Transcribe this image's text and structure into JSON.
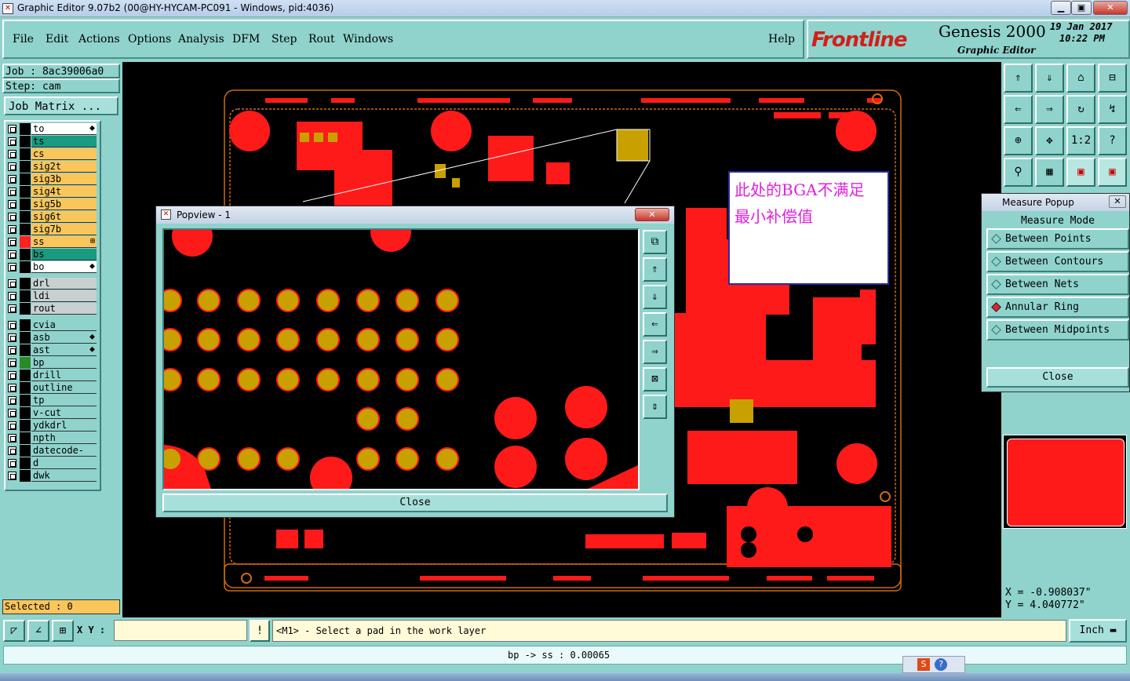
{
  "window": {
    "title": "Graphic Editor 9.07b2 (00@HY-HYCAM-PC091 - Windows, pid:4036)",
    "icon_glyph": "✕"
  },
  "menu": [
    "File",
    "Edit",
    "Actions",
    "Options",
    "Analysis",
    "DFM",
    "Step",
    "Rout",
    "Windows"
  ],
  "help_label": "Help",
  "brand": {
    "logo": "Frontline",
    "product": "Genesis 2000",
    "subtitle": "Graphic Editor",
    "date": "19 Jan 2017",
    "time": "10:22 PM"
  },
  "job": {
    "job_label": "Job : 8ac39006a0",
    "step_label": "Step: cam",
    "matrix_button": "Job Matrix ..."
  },
  "layers_group1": [
    {
      "name": "to",
      "color": "#ffffff",
      "swatch": "#000000",
      "icon": "⬥"
    },
    {
      "name": "ts",
      "color": "#1a9a80",
      "swatch": "#000000",
      "icon": ""
    },
    {
      "name": "cs",
      "color": "#f8c65b",
      "swatch": "#000000",
      "icon": ""
    },
    {
      "name": "sig2t",
      "color": "#f8c65b",
      "swatch": "#000000",
      "icon": ""
    },
    {
      "name": "sig3b",
      "color": "#f8c65b",
      "swatch": "#000000",
      "icon": ""
    },
    {
      "name": "sig4t",
      "color": "#f8c65b",
      "swatch": "#000000",
      "icon": ""
    },
    {
      "name": "sig5b",
      "color": "#f8c65b",
      "swatch": "#000000",
      "icon": ""
    },
    {
      "name": "sig6t",
      "color": "#f8c65b",
      "swatch": "#000000",
      "icon": ""
    },
    {
      "name": "sig7b",
      "color": "#f8c65b",
      "swatch": "#000000",
      "icon": ""
    },
    {
      "name": "ss",
      "color": "#f8c65b",
      "swatch": "#ff2020",
      "icon": "⊞"
    },
    {
      "name": "bs",
      "color": "#1a9a80",
      "swatch": "#000000",
      "icon": ""
    },
    {
      "name": "bo",
      "color": "#ffffff",
      "swatch": "#000000",
      "icon": "⬥"
    }
  ],
  "layers_group2": [
    {
      "name": "drl",
      "color": "#c8d0d0",
      "swatch": "#000000",
      "icon": ""
    },
    {
      "name": "ldi",
      "color": "#c8d0d0",
      "swatch": "#000000",
      "icon": ""
    },
    {
      "name": "rout",
      "color": "#c8d0d0",
      "swatch": "#000000",
      "icon": ""
    }
  ],
  "layers_group3": [
    {
      "name": "cvia",
      "color": "#8fd3cc",
      "swatch": "#000000",
      "icon": ""
    },
    {
      "name": "asb",
      "color": "#8fd3cc",
      "swatch": "#000000",
      "icon": "⬥"
    },
    {
      "name": "ast",
      "color": "#8fd3cc",
      "swatch": "#000000",
      "icon": "⬥"
    },
    {
      "name": "bp",
      "color": "#8fd3cc",
      "swatch": "#2a8a2a",
      "icon": ""
    },
    {
      "name": "drill",
      "color": "#8fd3cc",
      "swatch": "#000000",
      "icon": ""
    },
    {
      "name": "outline",
      "color": "#8fd3cc",
      "swatch": "#000000",
      "icon": ""
    },
    {
      "name": "tp",
      "color": "#8fd3cc",
      "swatch": "#000000",
      "icon": ""
    },
    {
      "name": "v-cut",
      "color": "#8fd3cc",
      "swatch": "#000000",
      "icon": ""
    },
    {
      "name": "ydkdrl",
      "color": "#8fd3cc",
      "swatch": "#000000",
      "icon": ""
    },
    {
      "name": "npth",
      "color": "#8fd3cc",
      "swatch": "#000000",
      "icon": ""
    },
    {
      "name": "datecode-pte",
      "color": "#8fd3cc",
      "swatch": "#000000",
      "icon": ""
    },
    {
      "name": "d",
      "color": "#8fd3cc",
      "swatch": "#000000",
      "icon": ""
    },
    {
      "name": "dwk",
      "color": "#8fd3cc",
      "swatch": "#000000",
      "icon": ""
    }
  ],
  "selected": "Selected : 0",
  "annotation": {
    "line1": "此处的BGA不满足",
    "line2": "最小补偿值"
  },
  "popview": {
    "title": "Popview - 1",
    "close": "Close",
    "icon_glyph": "✕",
    "close_x": "✕"
  },
  "measure": {
    "title": "Measure Popup",
    "mode_label": "Measure Mode",
    "close_x": "✕",
    "options": [
      "Between Points",
      "Between Contours",
      "Between Nets",
      "Annular Ring",
      "Between Midpoints"
    ],
    "selected": "Annular Ring",
    "close": "Close"
  },
  "coords": {
    "x": "X = -0.908037\"",
    "y": "Y = 4.040772\""
  },
  "status": {
    "xy_label": "X Y :",
    "prompt": "<M1> - Select a pad in the work layer",
    "units": "Inch",
    "info": "bp -> ss : 0.00065",
    "exclaim": "!"
  },
  "tools": {
    "t1": "⇑",
    "t2": "⇓",
    "t3": "⌂",
    "t4": "⊟",
    "t5": "⇐",
    "t6": "⇒",
    "t7": "↻",
    "t8": "↯",
    "t9": "⊕",
    "t10": "✥",
    "t11": "1:2",
    "t12": "?",
    "t13": "⚲",
    "t14": "▦",
    "t15": "▣",
    "t16": "▣"
  },
  "pop_tools": [
    "⧉",
    "⇑",
    "⇓",
    "⇐",
    "⇒",
    "⊠",
    "⇕"
  ],
  "colors": {
    "pad_red": "#ff1a1a",
    "pad_gold": "#c8a000",
    "outline_orange": "#d06a10",
    "panel": "#8fd3cc"
  }
}
